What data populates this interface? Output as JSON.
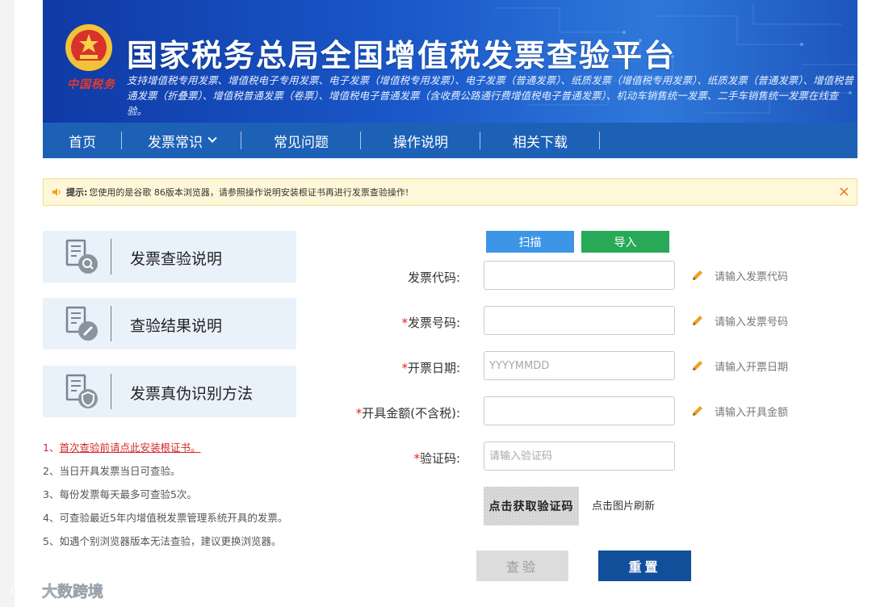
{
  "header": {
    "emblem_text": "中国税务",
    "title": "国家税务总局全国增值税发票查验平台",
    "subtitle": "支持增值税专用发票、增值税电子专用发票、电子发票（增值税专用发票）、电子发票（普通发票）、纸质发票（增值税专用发票）、纸质发票（普通发票）、增值税普通发票（折叠票）、增值税普通发票（卷票）、增值税电子普通发票（含收费公路通行费增值税电子普通发票）、机动车销售统一发票、二手车销售统一发票在线查验。"
  },
  "nav": {
    "items": [
      {
        "label": "首页"
      },
      {
        "label": "发票常识"
      },
      {
        "label": "常见问题"
      },
      {
        "label": "操作说明"
      },
      {
        "label": "相关下载"
      }
    ]
  },
  "notice": {
    "label": "提示:",
    "text": "您使用的是谷歌 86版本浏览器，请参照操作说明安装根证书再进行发票查验操作!",
    "close": "×"
  },
  "cards": [
    {
      "label": "发票查验说明",
      "icon": "document-search-icon"
    },
    {
      "label": "查验结果说明",
      "icon": "document-edit-icon"
    },
    {
      "label": "发票真伪识别方法",
      "icon": "document-shield-icon"
    }
  ],
  "notes": [
    {
      "prefix": "1、",
      "text": "首次查验前请点此安装根证书。"
    },
    {
      "prefix": "2、",
      "text": "当日开具发票当日可查验。"
    },
    {
      "prefix": "3、",
      "text": "每份发票每天最多可查验5次。"
    },
    {
      "prefix": "4、",
      "text": "可查验最近5年内增值税发票管理系统开具的发票。"
    },
    {
      "prefix": "5、",
      "text": "如遇个别浏览器版本无法查验，建议更换浏览器。"
    }
  ],
  "form": {
    "scan_label": "扫描",
    "import_label": "导入",
    "fields": [
      {
        "required": "",
        "label": "发票代码:",
        "value": "",
        "placeholder": "",
        "hint": "请输入发票代码"
      },
      {
        "required": "*",
        "label": "发票号码:",
        "value": "",
        "placeholder": "",
        "hint": "请输入发票号码"
      },
      {
        "required": "*",
        "label": "开票日期:",
        "value": "",
        "placeholder": "YYYYMMDD",
        "hint": "请输入开票日期"
      },
      {
        "required": "*",
        "label": "开具金额(不含税):",
        "value": "",
        "placeholder": "",
        "hint": "请输入开具金额"
      },
      {
        "required": "*",
        "label": "验证码:",
        "value": "",
        "placeholder": "请输入验证码",
        "hint": ""
      }
    ],
    "captcha_text": "点击获取验证码",
    "refresh_text": "点击图片刷新",
    "verify_label": "查验",
    "reset_label": "重置"
  },
  "watermark": {
    "text": "大数跨境"
  },
  "colors": {
    "banner_blue": "#1a58c9",
    "nav_blue": "#1d61b7",
    "scan_blue": "#3c95e6",
    "import_green": "#27a957",
    "reset_navy": "#124f9b",
    "notice_bg": "#fff8d8",
    "card_bg": "#e9f1fb",
    "required_red": "#e02020"
  }
}
